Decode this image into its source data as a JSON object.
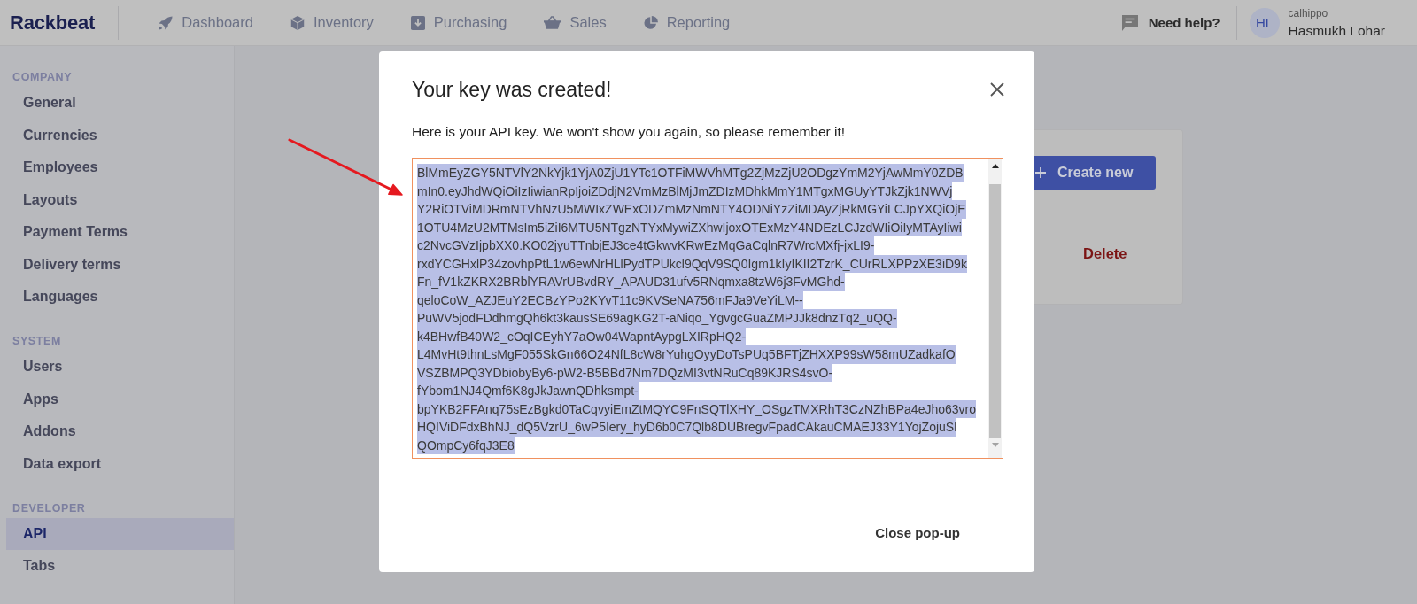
{
  "header": {
    "logo": "Rackbeat",
    "nav": [
      {
        "label": "Dashboard"
      },
      {
        "label": "Inventory"
      },
      {
        "label": "Purchasing"
      },
      {
        "label": "Sales"
      },
      {
        "label": "Reporting"
      }
    ],
    "help_link": "Need help?",
    "user": {
      "initials": "HL",
      "account": "calhippo",
      "name": "Hasmukh Lohar"
    }
  },
  "sidebar": {
    "sections": [
      {
        "title": "COMPANY",
        "items": [
          {
            "label": "General",
            "selected": false
          },
          {
            "label": "Currencies",
            "selected": false
          },
          {
            "label": "Employees",
            "selected": false
          },
          {
            "label": "Layouts",
            "selected": false
          },
          {
            "label": "Payment Terms",
            "selected": false
          },
          {
            "label": "Delivery terms",
            "selected": false
          },
          {
            "label": "Languages",
            "selected": false
          }
        ]
      },
      {
        "title": "SYSTEM",
        "items": [
          {
            "label": "Users",
            "selected": false
          },
          {
            "label": "Apps",
            "selected": false
          },
          {
            "label": "Addons",
            "selected": false
          },
          {
            "label": "Data export",
            "selected": false
          }
        ]
      },
      {
        "title": "DEVELOPER",
        "items": [
          {
            "label": "API",
            "selected": true
          },
          {
            "label": "Tabs",
            "selected": false
          }
        ]
      }
    ]
  },
  "api_page": {
    "create_button": "Create new",
    "delete_button": "Delete"
  },
  "modal": {
    "title": "Your key was created!",
    "message": "Here is your API key. We won't show you again, so please remember it!",
    "api_key_field": {
      "selected": true,
      "lines": [
        "BlMmEyZGY5NTVlY2NkYjk1YjA0ZjU1YTc1OTFiMWVhMTg2ZjMzZjU2ODgzYmM2YjAwMmY0ZDB",
        "mIn0.eyJhdWQiOiIzIiwianRpIjoiZDdjN2VmMzBlMjJmZDIzMDhkMmY1MTgxMGUyYTJkZjk1NWVj",
        "Y2RiOTViMDRmNTVhNzU5MWIxZWExODZmMzNmNTY4ODNiYzZiMDAyZjRkMGYiLCJpYXQiOjE",
        "1OTU4MzU2MTMsIm5iZiI6MTU5NTgzNTYxMywiZXhwIjoxOTExMzY4NDEzLCJzdWIiOiIyMTAyIiwi",
        "c2NvcGVzIjpbXX0.KO02jyuTTnbjEJ3ce4tGkwvKRwEzMqGaCqlnR7WrcMXfj-jxLI9-",
        "rxdYCGHxlP34zovhpPtL1w6ewNrHLlPydTPUkcl9QqV9SQ0Igm1kIyIKII2TzrK_CUrRLXPPzXE3iD9k",
        "Fn_fV1kZKRX2BRblYRAVrUBvdRY_APAUD31ufv5RNqmxa8tzW6j3FvMGhd-",
        "qeloCoW_AZJEuY2ECBzYPo2KYvT11c9KVSeNA756mFJa9VeYiLM--",
        "PuWV5jodFDdhmgQh6kt3kausSE69agKG2T-aNiqo_YgvgcGuaZMPJJk8dnzTq2_uQQ-",
        "k4BHwfB40W2_cOqICEyhY7aOw04WapntAypgLXIRpHQ2-",
        "L4MvHt9thnLsMgF055SkGn66O24NfL8cW8rYuhgOyyDoTsPUq5BFTjZHXXP99sW58mUZadkafO",
        "VSZBMPQ3YDbiobyBy6-pW2-B5BBd7Nm7DQzMI3vtNRuCq89KJRS4svO-",
        "fYbom1NJ4Qmf6K8gJkJawnQDhksmpt-",
        "bpYKB2FFAnq75sEzBgkd0TaCqvyiEmZtMQYC9FnSQTlXHY_OSgzTMXRhT3CzNZhBPa4eJho63vro",
        "HQIViDFdxBhNJ_dQ5VzrU_6wP5Iery_hyD6b0C7Qlb8DUBregvFpadCAkauCMAEJ33Y1YojZojuSl",
        "QOmpCy6fqJ3E8"
      ]
    },
    "close_button": "Close pop-up"
  }
}
